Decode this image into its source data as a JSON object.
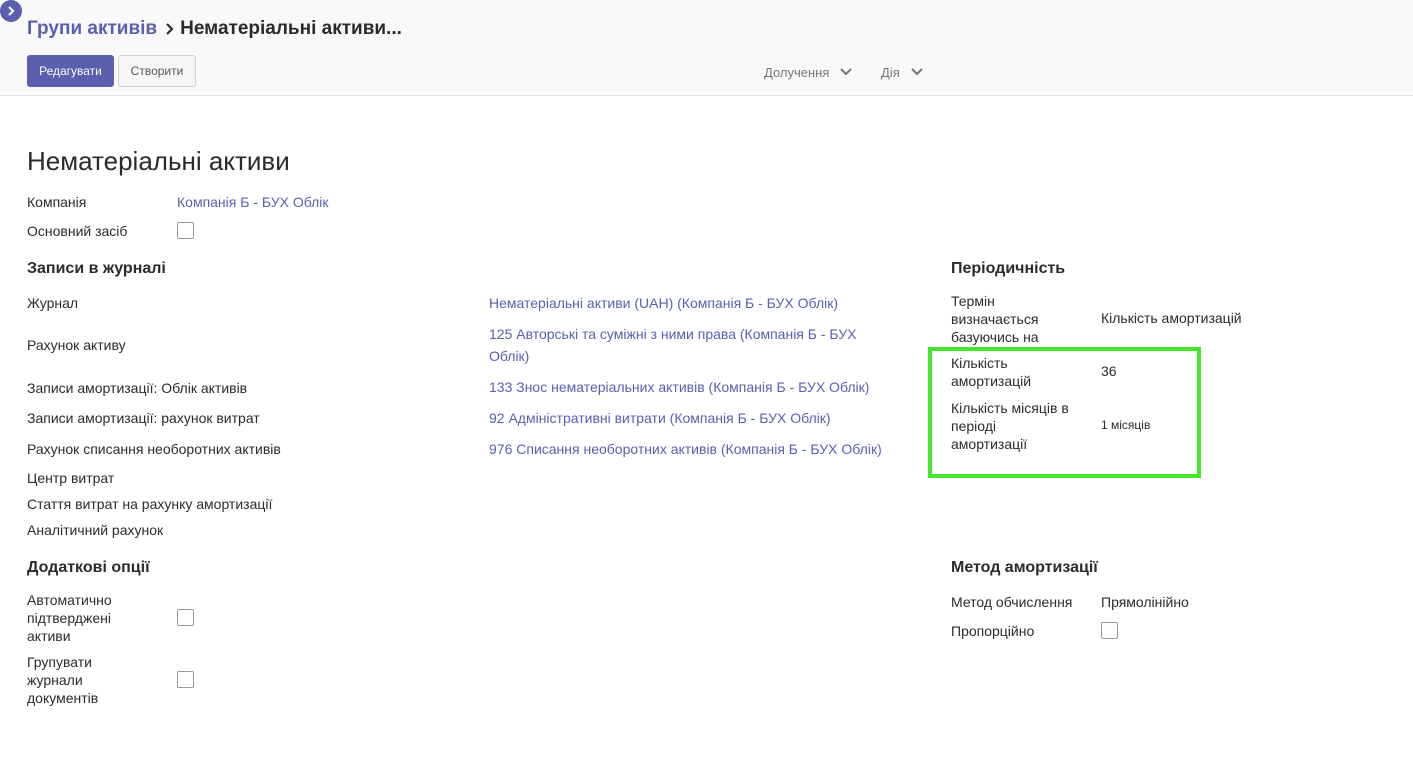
{
  "colors": {
    "accent": "#5a5fb0",
    "highlight": "#45e62a"
  },
  "header": {
    "toggle_icon": "chevron-right-icon",
    "breadcrumb": {
      "parent": "Групи активів",
      "separator_icon": "chevron-right-icon",
      "current": "Нематеріальні активи..."
    },
    "buttons": {
      "edit": "Редагувати",
      "create": "Створити"
    },
    "dropdowns": {
      "attachments": "Долучення",
      "action": "Дія"
    }
  },
  "form": {
    "title": "Нематеріальні активи",
    "company_label": "Компанія",
    "company_value": "Компанія Б - БУХ Облік",
    "fixed_asset_label": "Основний засіб",
    "fixed_asset_checked": false,
    "journal_section": {
      "title": "Записи в журналі",
      "rows": [
        {
          "label": "Журнал",
          "value": "Нематеріальні активи (UAH) (Компанія Б - БУХ Облік)"
        },
        {
          "label": "Рахунок активу",
          "value_line1": "125 Авторські та суміжні з ними права (Компанія Б - БУХ",
          "value_line2": "Облік)"
        },
        {
          "label": "Записи амортизації: Облік активів",
          "value": "133 Знос нематеріальних активів (Компанія Б - БУХ Облік)"
        },
        {
          "label": "Записи амортизації: рахунок витрат",
          "value": "92 Адміністративні витрати (Компанія Б - БУХ Облік)"
        },
        {
          "label": "Рахунок списання необоротних активів",
          "value": "976 Списання необоротних активів (Компанія Б - БУХ Облік)"
        },
        {
          "label": "Центр витрат",
          "value": ""
        },
        {
          "label": "Стаття витрат на рахунку амортизації",
          "value": ""
        },
        {
          "label": "Аналітичний рахунок",
          "value": ""
        }
      ]
    },
    "periodicity_section": {
      "title": "Періодичність",
      "time_method_label": [
        "Термін",
        "визначається",
        "базуючись на"
      ],
      "time_method_value": "Кількість амортизацій",
      "number_label": [
        "Кількість",
        "амортизацій"
      ],
      "number_value": "36",
      "months_label": [
        "Кількість місяців в",
        "періоді",
        "амортизації"
      ],
      "months_value": "1 місяців"
    },
    "options_section": {
      "title": "Додаткові опції",
      "auto_confirm_label": [
        "Автоматично",
        "підтверджені",
        "активи"
      ],
      "auto_confirm_checked": false,
      "group_entries_label": [
        "Групувати",
        "журнали",
        "документів"
      ],
      "group_entries_checked": false
    },
    "method_section": {
      "title": "Метод амортизації",
      "method_label": "Метод обчислення",
      "method_value": "Прямолінійно",
      "prorata_label": "Пропорційно",
      "prorata_checked": false
    }
  }
}
